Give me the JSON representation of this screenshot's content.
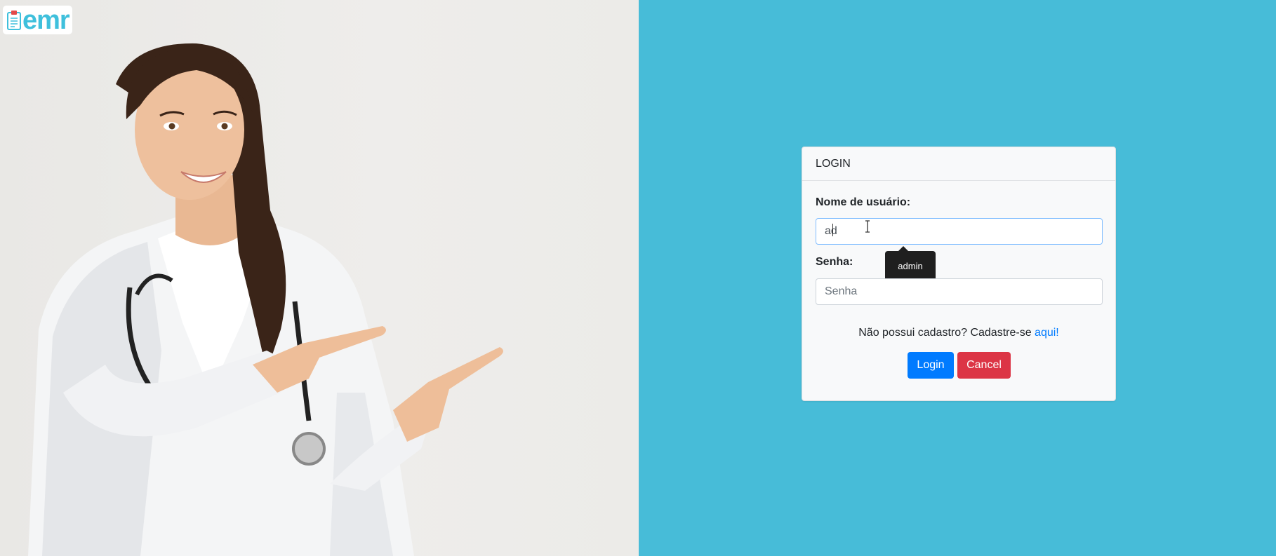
{
  "brand": {
    "logo_text": "emr"
  },
  "login_card": {
    "title": "LOGIN",
    "username": {
      "label": "Nome de usuário:",
      "value": "ad"
    },
    "autocomplete_suggestion": "admin",
    "password": {
      "label": "Senha:",
      "placeholder": "Senha",
      "value": ""
    },
    "register_prompt": "Não possui cadastro? Cadastre-se ",
    "register_link": "aqui!",
    "login_button": "Login",
    "cancel_button": "Cancel"
  },
  "colors": {
    "background_right": "#47bcd8",
    "brand": "#3fc0dc",
    "primary": "#007bff",
    "danger": "#dc3545"
  }
}
